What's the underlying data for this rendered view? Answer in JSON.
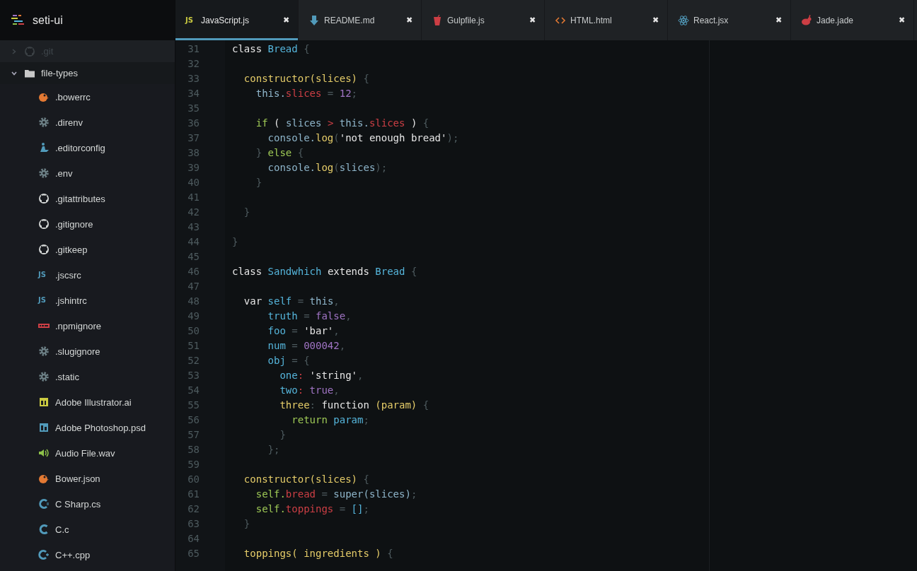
{
  "project": {
    "title": "seti-ui"
  },
  "tree": [
    {
      "label": ".git",
      "kind": "github",
      "expanded": false,
      "dimmed": true
    },
    {
      "label": "file-types",
      "kind": "folder",
      "expanded": true,
      "dimmed": false,
      "children": [
        {
          "label": ".bowerrc",
          "kind": "bower"
        },
        {
          "label": ".direnv",
          "kind": "gear"
        },
        {
          "label": ".editorconfig",
          "kind": "editorconfig"
        },
        {
          "label": ".env",
          "kind": "gear"
        },
        {
          "label": ".gitattributes",
          "kind": "github"
        },
        {
          "label": ".gitignore",
          "kind": "github"
        },
        {
          "label": ".gitkeep",
          "kind": "github"
        },
        {
          "label": ".jscsrc",
          "kind": "js",
          "icon_text": "JS"
        },
        {
          "label": ".jshintrc",
          "kind": "js",
          "icon_text": "JS"
        },
        {
          "label": ".npmignore",
          "kind": "npm"
        },
        {
          "label": ".slugignore",
          "kind": "gear"
        },
        {
          "label": ".static",
          "kind": "gear"
        },
        {
          "label": "Adobe Illustrator.ai",
          "kind": "ai"
        },
        {
          "label": "Adobe Photoshop.psd",
          "kind": "ps"
        },
        {
          "label": "Audio File.wav",
          "kind": "audio"
        },
        {
          "label": "Bower.json",
          "kind": "bower"
        },
        {
          "label": "C Sharp.cs",
          "kind": "csharp"
        },
        {
          "label": "C.c",
          "kind": "c"
        },
        {
          "label": "C++.cpp",
          "kind": "cpp"
        }
      ]
    }
  ],
  "tabs": [
    {
      "label": "JavaScript.js",
      "kind": "js",
      "icon_text": "JS",
      "selected": true,
      "close": "✖"
    },
    {
      "label": "README.md",
      "kind": "markdown",
      "selected": false,
      "close": "✖"
    },
    {
      "label": "Gulpfile.js",
      "kind": "gulp",
      "selected": false,
      "close": "✖"
    },
    {
      "label": "HTML.html",
      "kind": "html",
      "selected": false,
      "close": "✖"
    },
    {
      "label": "React.jsx",
      "kind": "react",
      "selected": false,
      "close": "✖"
    },
    {
      "label": "Jade.jade",
      "kind": "jade",
      "selected": false,
      "close": "✖"
    }
  ],
  "editor": {
    "lines": [
      {
        "number": "31",
        "tokens": [
          {
            "text": "class ",
            "kind": "kw"
          },
          {
            "text": "Bread ",
            "kind": "cls"
          },
          {
            "text": "{",
            "kind": "punc"
          }
        ]
      },
      {
        "number": "32"
      },
      {
        "number": "33",
        "tokens": [
          {
            "text": "  constructor(slices) ",
            "kind": "fn"
          },
          {
            "text": "{",
            "kind": "punc"
          }
        ]
      },
      {
        "number": "34",
        "tokens": [
          {
            "text": "    this.",
            "kind": "var"
          },
          {
            "text": "slices",
            "kind": "prop"
          },
          {
            "text": " = ",
            "kind": "punc"
          },
          {
            "text": "12",
            "kind": "num"
          },
          {
            "text": ";",
            "kind": "punc"
          }
        ]
      },
      {
        "number": "35"
      },
      {
        "number": "36",
        "tokens": [
          {
            "text": "    if ",
            "kind": "ctrl"
          },
          {
            "text": "( ",
            "kind": "kw"
          },
          {
            "text": "slices ",
            "kind": "var"
          },
          {
            "text": "> ",
            "kind": "prop"
          },
          {
            "text": "this.",
            "kind": "var"
          },
          {
            "text": "slices",
            "kind": "prop"
          },
          {
            "text": " ) ",
            "kind": "kw"
          },
          {
            "text": "{",
            "kind": "punc"
          }
        ]
      },
      {
        "number": "37",
        "tokens": [
          {
            "text": "      console.",
            "kind": "var"
          },
          {
            "text": "log",
            "kind": "fn"
          },
          {
            "text": "(",
            "kind": "punc"
          },
          {
            "text": "'not enough bread'",
            "kind": "str"
          },
          {
            "text": ");",
            "kind": "punc"
          }
        ]
      },
      {
        "number": "38",
        "tokens": [
          {
            "text": "    } ",
            "kind": "punc"
          },
          {
            "text": "else ",
            "kind": "ctrl"
          },
          {
            "text": "{",
            "kind": "punc"
          }
        ]
      },
      {
        "number": "39",
        "tokens": [
          {
            "text": "      console.",
            "kind": "var"
          },
          {
            "text": "log",
            "kind": "fn"
          },
          {
            "text": "(",
            "kind": "punc"
          },
          {
            "text": "slices",
            "kind": "var"
          },
          {
            "text": ");",
            "kind": "punc"
          }
        ]
      },
      {
        "number": "40",
        "tokens": [
          {
            "text": "    }",
            "kind": "punc"
          }
        ]
      },
      {
        "number": "41"
      },
      {
        "number": "42",
        "tokens": [
          {
            "text": "  }",
            "kind": "punc"
          }
        ]
      },
      {
        "number": "43"
      },
      {
        "number": "44",
        "tokens": [
          {
            "text": "}",
            "kind": "punc"
          }
        ]
      },
      {
        "number": "45"
      },
      {
        "number": "46",
        "tokens": [
          {
            "text": "class ",
            "kind": "kw"
          },
          {
            "text": "Sandwhich ",
            "kind": "cls"
          },
          {
            "text": "extends ",
            "kind": "kw"
          },
          {
            "text": "Bread ",
            "kind": "cls"
          },
          {
            "text": "{",
            "kind": "punc"
          }
        ]
      },
      {
        "number": "47"
      },
      {
        "number": "48",
        "tokens": [
          {
            "text": "  var ",
            "kind": "kw"
          },
          {
            "text": "self ",
            "kind": "cls"
          },
          {
            "text": "= ",
            "kind": "punc"
          },
          {
            "text": "this",
            "kind": "var"
          },
          {
            "text": ",",
            "kind": "punc"
          }
        ]
      },
      {
        "number": "49",
        "tokens": [
          {
            "text": "      truth ",
            "kind": "cls"
          },
          {
            "text": "= ",
            "kind": "punc"
          },
          {
            "text": "false",
            "kind": "num"
          },
          {
            "text": ",",
            "kind": "punc"
          }
        ]
      },
      {
        "number": "50",
        "tokens": [
          {
            "text": "      foo ",
            "kind": "cls"
          },
          {
            "text": "= ",
            "kind": "punc"
          },
          {
            "text": "'bar'",
            "kind": "str"
          },
          {
            "text": ",",
            "kind": "punc"
          }
        ]
      },
      {
        "number": "51",
        "tokens": [
          {
            "text": "      num ",
            "kind": "cls"
          },
          {
            "text": "= ",
            "kind": "punc"
          },
          {
            "text": "000042",
            "kind": "num"
          },
          {
            "text": ",",
            "kind": "punc"
          }
        ]
      },
      {
        "number": "52",
        "tokens": [
          {
            "text": "      obj ",
            "kind": "cls"
          },
          {
            "text": "= {",
            "kind": "punc"
          }
        ]
      },
      {
        "number": "53",
        "tokens": [
          {
            "text": "        one",
            "kind": "cls"
          },
          {
            "text": ": ",
            "kind": "prop"
          },
          {
            "text": "'string'",
            "kind": "str"
          },
          {
            "text": ",",
            "kind": "punc"
          }
        ]
      },
      {
        "number": "54",
        "tokens": [
          {
            "text": "        two",
            "kind": "cls"
          },
          {
            "text": ": ",
            "kind": "prop"
          },
          {
            "text": "true",
            "kind": "num"
          },
          {
            "text": ",",
            "kind": "punc"
          }
        ]
      },
      {
        "number": "55",
        "tokens": [
          {
            "text": "        three",
            "kind": "fn"
          },
          {
            "text": ": ",
            "kind": "punc"
          },
          {
            "text": "function ",
            "kind": "kw"
          },
          {
            "text": "(param) ",
            "kind": "fn"
          },
          {
            "text": "{",
            "kind": "punc"
          }
        ]
      },
      {
        "number": "56",
        "tokens": [
          {
            "text": "          return ",
            "kind": "ctrl"
          },
          {
            "text": "param",
            "kind": "cls"
          },
          {
            "text": ";",
            "kind": "punc"
          }
        ]
      },
      {
        "number": "57",
        "tokens": [
          {
            "text": "        }",
            "kind": "punc"
          }
        ]
      },
      {
        "number": "58",
        "tokens": [
          {
            "text": "      };",
            "kind": "punc"
          }
        ]
      },
      {
        "number": "59"
      },
      {
        "number": "60",
        "tokens": [
          {
            "text": "  constructor(slices) ",
            "kind": "fn"
          },
          {
            "text": "{",
            "kind": "punc"
          }
        ]
      },
      {
        "number": "61",
        "tokens": [
          {
            "text": "    self.",
            "kind": "ctrl"
          },
          {
            "text": "bread",
            "kind": "prop"
          },
          {
            "text": " = ",
            "kind": "punc"
          },
          {
            "text": "super(slices)",
            "kind": "var"
          },
          {
            "text": ";",
            "kind": "punc"
          }
        ]
      },
      {
        "number": "62",
        "tokens": [
          {
            "text": "    self.",
            "kind": "ctrl"
          },
          {
            "text": "toppings",
            "kind": "prop"
          },
          {
            "text": " = ",
            "kind": "punc"
          },
          {
            "text": "[]",
            "kind": "cls"
          },
          {
            "text": ";",
            "kind": "punc"
          }
        ]
      },
      {
        "number": "63",
        "tokens": [
          {
            "text": "  }",
            "kind": "punc"
          }
        ]
      },
      {
        "number": "64"
      },
      {
        "number": "65",
        "tokens": [
          {
            "text": "  toppings( ingredients ) ",
            "kind": "fn"
          },
          {
            "text": "{",
            "kind": "punc"
          }
        ]
      }
    ]
  }
}
